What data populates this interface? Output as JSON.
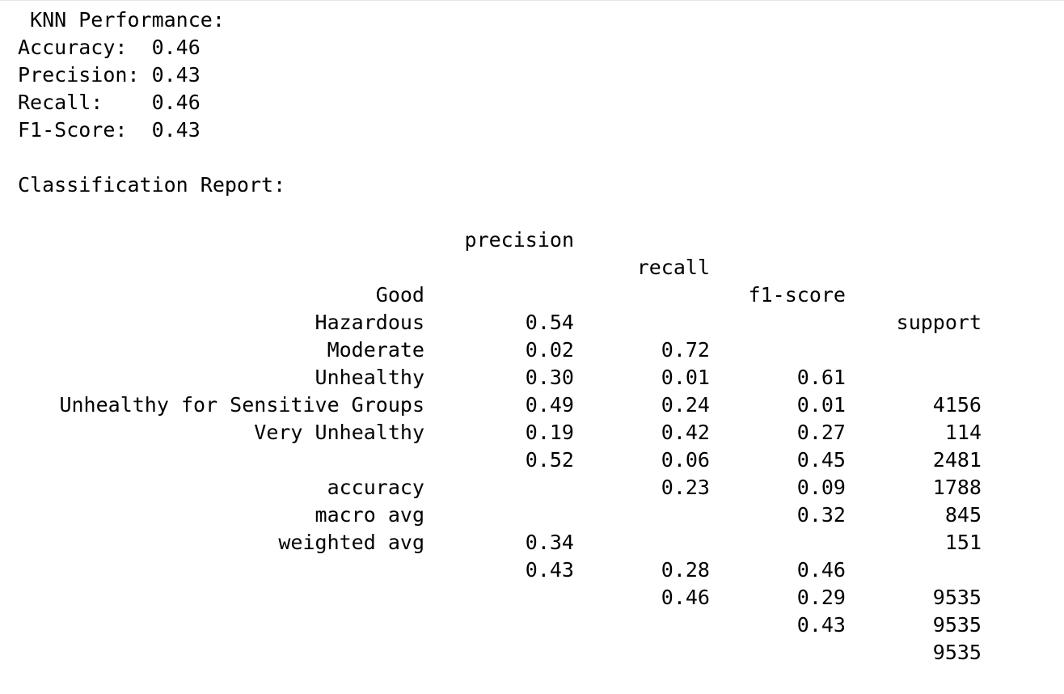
{
  "performance": {
    "title": " KNN Performance:",
    "metrics": [
      {
        "label": "Accuracy:  ",
        "value": "0.46"
      },
      {
        "label": "Precision: ",
        "value": "0.43"
      },
      {
        "label": "Recall:    ",
        "value": "0.46"
      },
      {
        "label": "F1-Score:  ",
        "value": "0.43"
      }
    ]
  },
  "report": {
    "title": "Classification Report:",
    "headers": [
      "precision",
      "recall",
      "f1-score",
      "support"
    ],
    "classes": [
      {
        "label": "Good",
        "precision": "0.54",
        "recall": "0.72",
        "f1": "0.61",
        "support": "4156"
      },
      {
        "label": "Hazardous",
        "precision": "0.02",
        "recall": "0.01",
        "f1": "0.01",
        "support": "114"
      },
      {
        "label": "Moderate",
        "precision": "0.30",
        "recall": "0.24",
        "f1": "0.27",
        "support": "2481"
      },
      {
        "label": "Unhealthy",
        "precision": "0.49",
        "recall": "0.42",
        "f1": "0.45",
        "support": "1788"
      },
      {
        "label": "Unhealthy for Sensitive Groups",
        "precision": "0.19",
        "recall": "0.06",
        "f1": "0.09",
        "support": "845"
      },
      {
        "label": "Very Unhealthy",
        "precision": "0.52",
        "recall": "0.23",
        "f1": "0.32",
        "support": "151"
      }
    ],
    "summary": [
      {
        "label": "accuracy",
        "precision": "",
        "recall": "",
        "f1": "0.46",
        "support": "9535"
      },
      {
        "label": "macro avg",
        "precision": "0.34",
        "recall": "0.28",
        "f1": "0.29",
        "support": "9535"
      },
      {
        "label": "weighted avg",
        "precision": "0.43",
        "recall": "0.46",
        "f1": "0.43",
        "support": "9535"
      }
    ]
  }
}
